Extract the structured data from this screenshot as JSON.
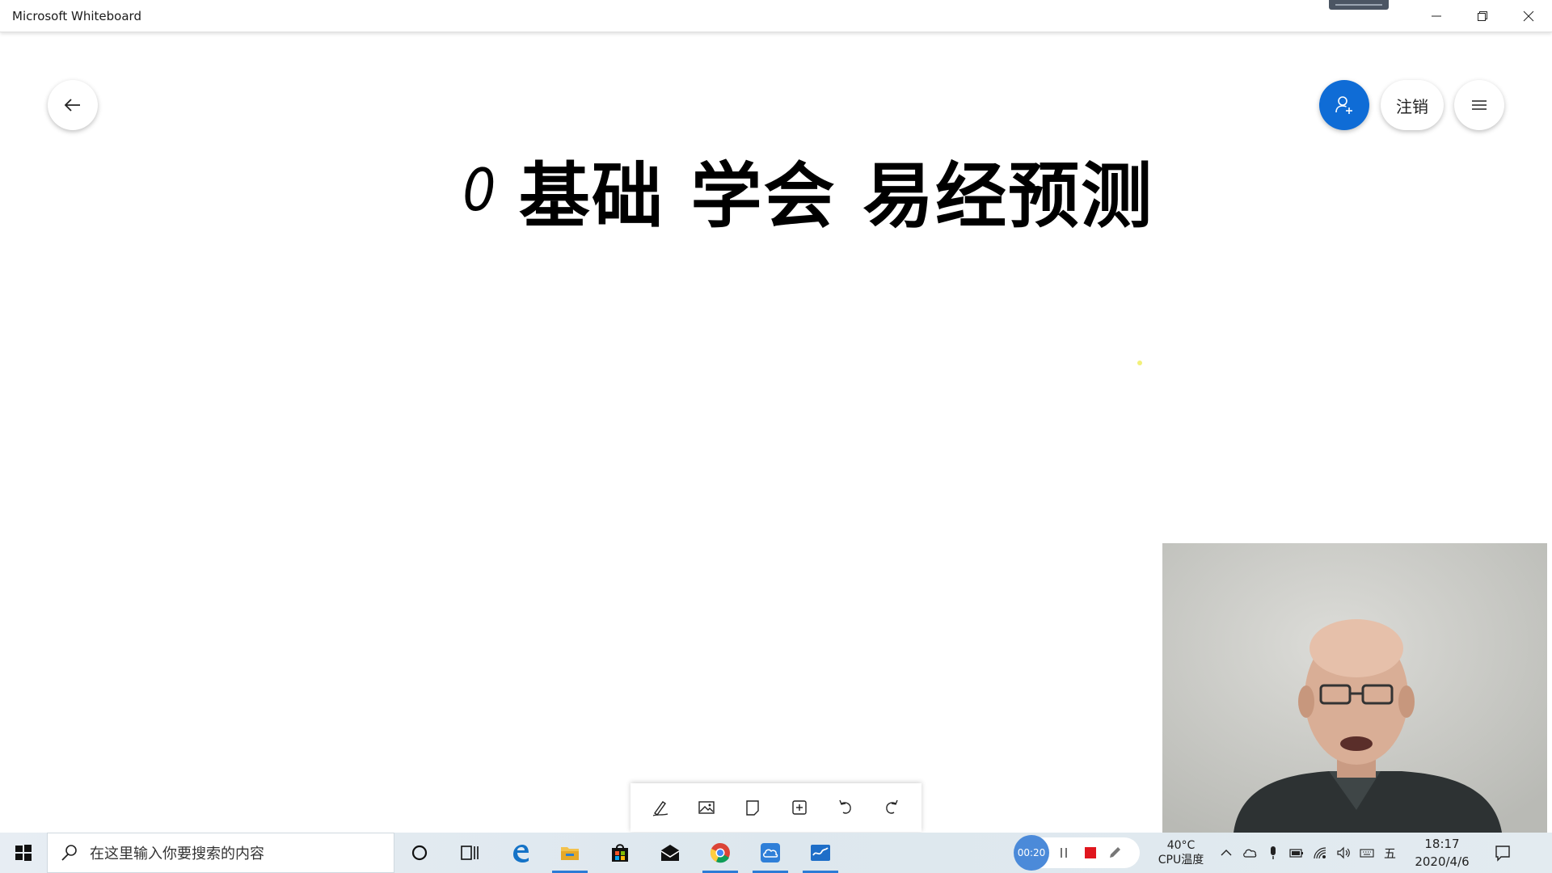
{
  "window": {
    "title": "Microsoft Whiteboard",
    "controls": [
      "minimize-icon",
      "restore-icon",
      "close-icon"
    ]
  },
  "header": {
    "back_icon": "arrow-left-icon",
    "invite_icon": "person-add-icon",
    "signout_label": "注销",
    "menu_icon": "hamburger-menu-icon",
    "accent": "#0f6cd6"
  },
  "board": {
    "title_digit": "0",
    "title_text": "基础 学会 易经预测"
  },
  "toolbar": {
    "tools": [
      "pen-icon",
      "image-icon",
      "sticky-note-icon",
      "insert-icon",
      "undo-icon",
      "redo-icon"
    ]
  },
  "taskbar": {
    "search_placeholder": "在这里输入你要搜索的内容",
    "apps": [
      "cortana-icon",
      "task-view-icon",
      "edge-icon",
      "file-explorer-icon",
      "store-icon",
      "mail-icon",
      "chrome-icon",
      "cloud-app-icon",
      "whiteboard-icon"
    ],
    "recorder": {
      "timer": "00:20"
    },
    "cpu_temp": "40°C",
    "cpu_label": "CPU温度",
    "ime": "五",
    "time": "18:17",
    "date": "2020/4/6"
  }
}
